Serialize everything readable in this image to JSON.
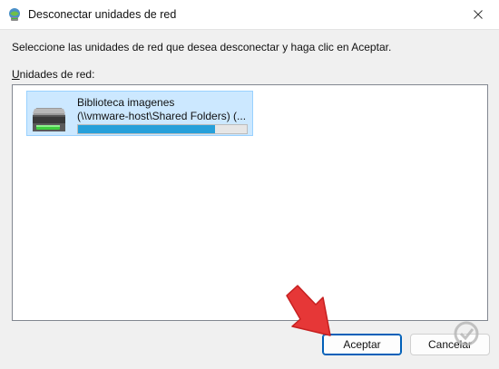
{
  "window": {
    "title": "Desconectar unidades de red",
    "icon": "network-drive-disconnect-icon"
  },
  "instruction": "Seleccione las unidades de red que desea desconectar y haga clic en Aceptar.",
  "list": {
    "label_accel": "U",
    "label_rest": "nidades de red:",
    "items": [
      {
        "name": "Biblioteca imagenes",
        "path": "(\\\\vmware-host\\Shared Folders) (...",
        "icon": "network-drive-icon",
        "used_fraction": 0.81,
        "selected": true
      }
    ]
  },
  "buttons": {
    "ok": "Aceptar",
    "cancel": "Cancelar"
  },
  "colors": {
    "selection_bg": "#cce8ff",
    "capacity_fill": "#26a0da",
    "annotation_arrow": "#e63737"
  }
}
